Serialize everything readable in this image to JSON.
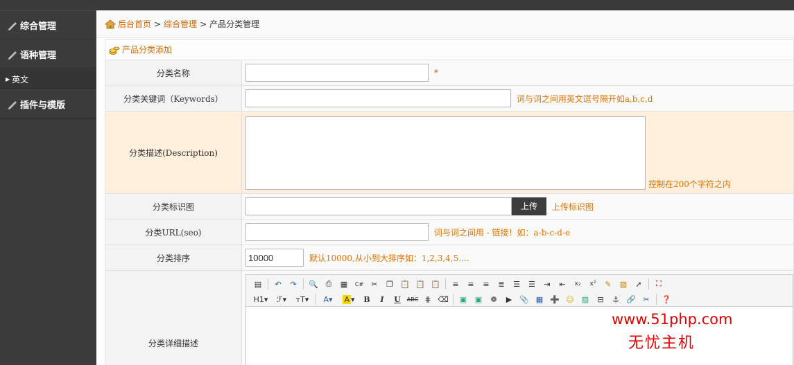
{
  "sidebar": {
    "groups": [
      {
        "label": "综合管理"
      },
      {
        "label": "语种管理"
      },
      {
        "label": "英文"
      },
      {
        "label": "插件与模版"
      }
    ]
  },
  "breadcrumb": {
    "home": "后台首页",
    "sep": ">",
    "section": "综合管理",
    "current": "产品分类管理"
  },
  "panel": {
    "title": "产品分类添加"
  },
  "form": {
    "name": {
      "label": "分类名称",
      "value": "",
      "required": "*"
    },
    "keywords": {
      "label": "分类关键词（Keywords）",
      "value": "",
      "hint": "词与词之间用英文逗号隔开如a,b,c,d"
    },
    "description": {
      "label": "分类描述(Description)",
      "value": "",
      "hint": "控制在200个字符之内"
    },
    "image": {
      "label": "分类标识图",
      "value": "",
      "button": "上传",
      "hint": "上传标识图"
    },
    "url": {
      "label": "分类URL(seo)",
      "value": "",
      "hint": "词与词之间用 - 链接！如：a-b-c-d-e"
    },
    "order": {
      "label": "分类排序",
      "value": "10000",
      "hint": "默认10000,从小到大排序如：1,2,3,4,5...."
    },
    "detail": {
      "label": "分类详细描述"
    }
  },
  "editor": {
    "toolbar_text": {
      "h1": "H1",
      "font": "ℱ",
      "size": "тT",
      "color": "A",
      "bg": "A",
      "bold": "B",
      "italic": "I",
      "underline": "U",
      "strike": "ABC"
    }
  },
  "watermark": {
    "line1": "www.51php.com",
    "line2": "无忧主机"
  },
  "colors": {
    "accent": "#d06a00",
    "hint": "#e07200",
    "sidebar_bg": "#3b3b3b",
    "highlight_row": "#fef0dc",
    "watermark": "#e00000"
  }
}
